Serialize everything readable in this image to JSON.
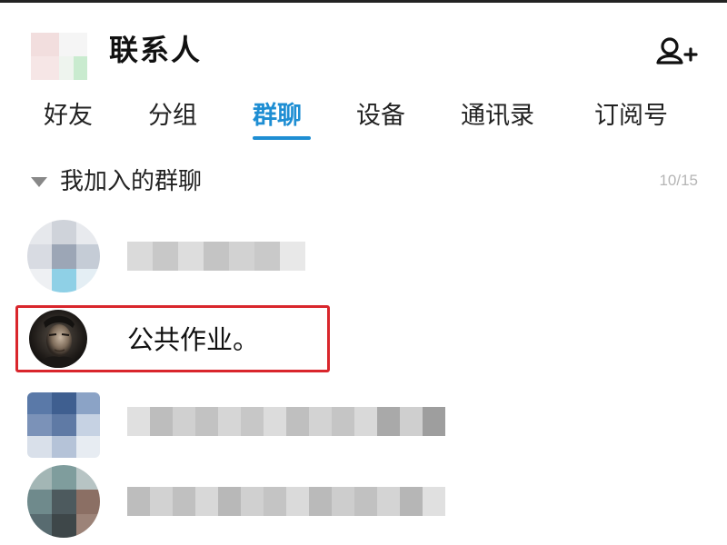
{
  "header": {
    "title": "联系人",
    "add_contact_icon": "add-contact-icon"
  },
  "tabs": [
    {
      "label": "好友"
    },
    {
      "label": "分组"
    },
    {
      "label": "群聊",
      "active": true
    },
    {
      "label": "设备"
    },
    {
      "label": "通讯录"
    },
    {
      "label": "订阅号"
    }
  ],
  "section": {
    "title": "我加入的群聊",
    "count": "10/15",
    "expanded_icon": "caret-down-icon"
  },
  "groups": [
    {
      "name_blurred": true
    },
    {
      "name": "公共作业。",
      "highlighted": true
    },
    {
      "name_blurred": true
    },
    {
      "name_blurred": true
    }
  ],
  "colors": {
    "accent": "#1e8ed3",
    "highlight_border": "#d9262c",
    "count_text": "#b5b5b5"
  }
}
